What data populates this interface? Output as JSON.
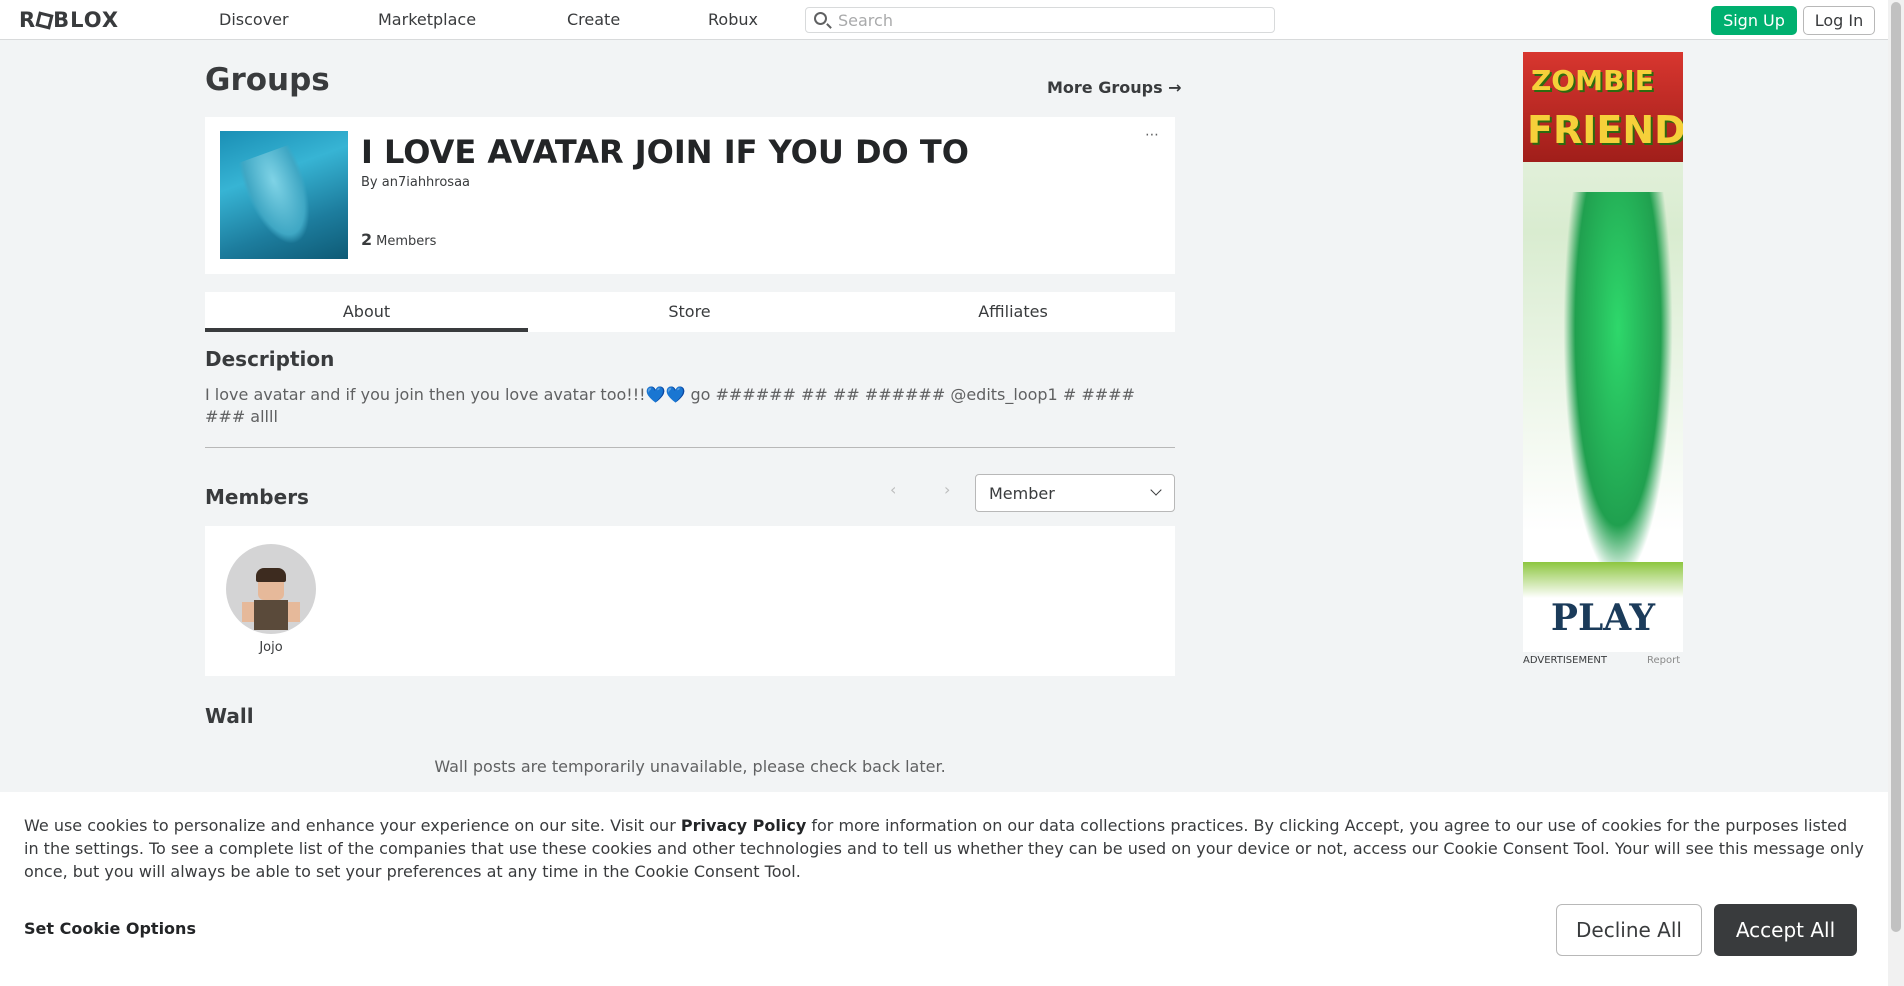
{
  "nav": {
    "logo": "ROBLOX",
    "links": [
      "Discover",
      "Marketplace",
      "Create",
      "Robux"
    ],
    "search_placeholder": "Search",
    "signup_label": "Sign Up",
    "login_label": "Log In"
  },
  "page": {
    "title": "Groups",
    "more_groups": "More Groups →"
  },
  "group": {
    "name": "I LOVE AVATAR JOIN IF YOU DO TO",
    "by_label": "By",
    "owner": "an7iahhrosaa",
    "member_count": "2",
    "members_label": "Members",
    "more_menu": "⋯"
  },
  "tabs": [
    "About",
    "Store",
    "Affiliates"
  ],
  "about": {
    "description_heading": "Description",
    "description_text": "I love avatar and if you join then you love avatar too!!!💙💙 go ###### ## ## ###### @edits_loop1 # #### ### allll"
  },
  "members": {
    "heading": "Members",
    "role_selected": "Member",
    "list": [
      {
        "name": "Jojo"
      }
    ]
  },
  "wall": {
    "heading": "Wall",
    "message": "Wall posts are temporarily unavailable, please check back later."
  },
  "ad": {
    "title_line1": "ZOMBIE",
    "title_line2": "FRIEND",
    "play": "PLAY",
    "label": "ADVERTISEMENT",
    "report": "Report"
  },
  "cookie": {
    "text_before": "We use cookies to personalize and enhance your experience on our site. Visit our ",
    "privacy_link": "Privacy Policy",
    "text_after": " for more information on our data collections practices. By clicking Accept, you agree to our use of cookies for the purposes listed in the settings. To see a complete list of the companies that use these cookies and other technologies and to tell us whether they can be used on your device or not, access our Cookie Consent Tool. Your will see this message only once, but you will always be able to set your preferences at any time in the Cookie Consent Tool.",
    "options_label": "Set Cookie Options",
    "decline_label": "Decline All",
    "accept_label": "Accept All"
  },
  "colors": {
    "signup": "#00b06f",
    "accept": "#393b3d",
    "background": "#f2f4f5"
  }
}
